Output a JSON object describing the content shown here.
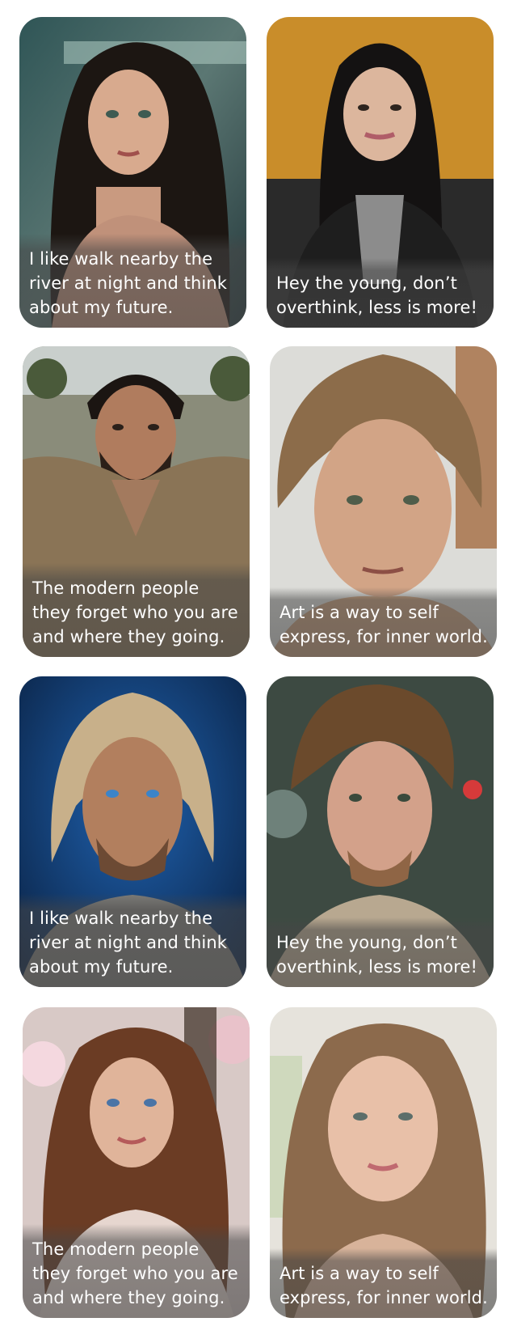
{
  "cards": [
    {
      "caption_lines": [
        "I like walk nearby the",
        "river at night and think",
        "about my future."
      ]
    },
    {
      "caption_lines": [
        "Hey the young, don’t",
        "overthink, less is more!"
      ]
    },
    {
      "caption_lines": [
        "The modern people",
        "they forget who you are",
        "and where they going."
      ]
    },
    {
      "caption_lines": [
        "Art is a way to self",
        "express, for inner world."
      ]
    },
    {
      "caption_lines": [
        "I like walk nearby the",
        "river at night and think",
        "about my future."
      ]
    },
    {
      "caption_lines": [
        "Hey the young, don’t",
        "overthink, less is more!"
      ]
    },
    {
      "caption_lines": [
        "The modern people",
        "they forget who you are",
        "and where they going."
      ]
    },
    {
      "caption_lines": [
        "Art is a way to self",
        "express, for inner world."
      ]
    }
  ],
  "colors": {
    "caption_text": "#ffffff",
    "page_background": "#ffffff"
  }
}
